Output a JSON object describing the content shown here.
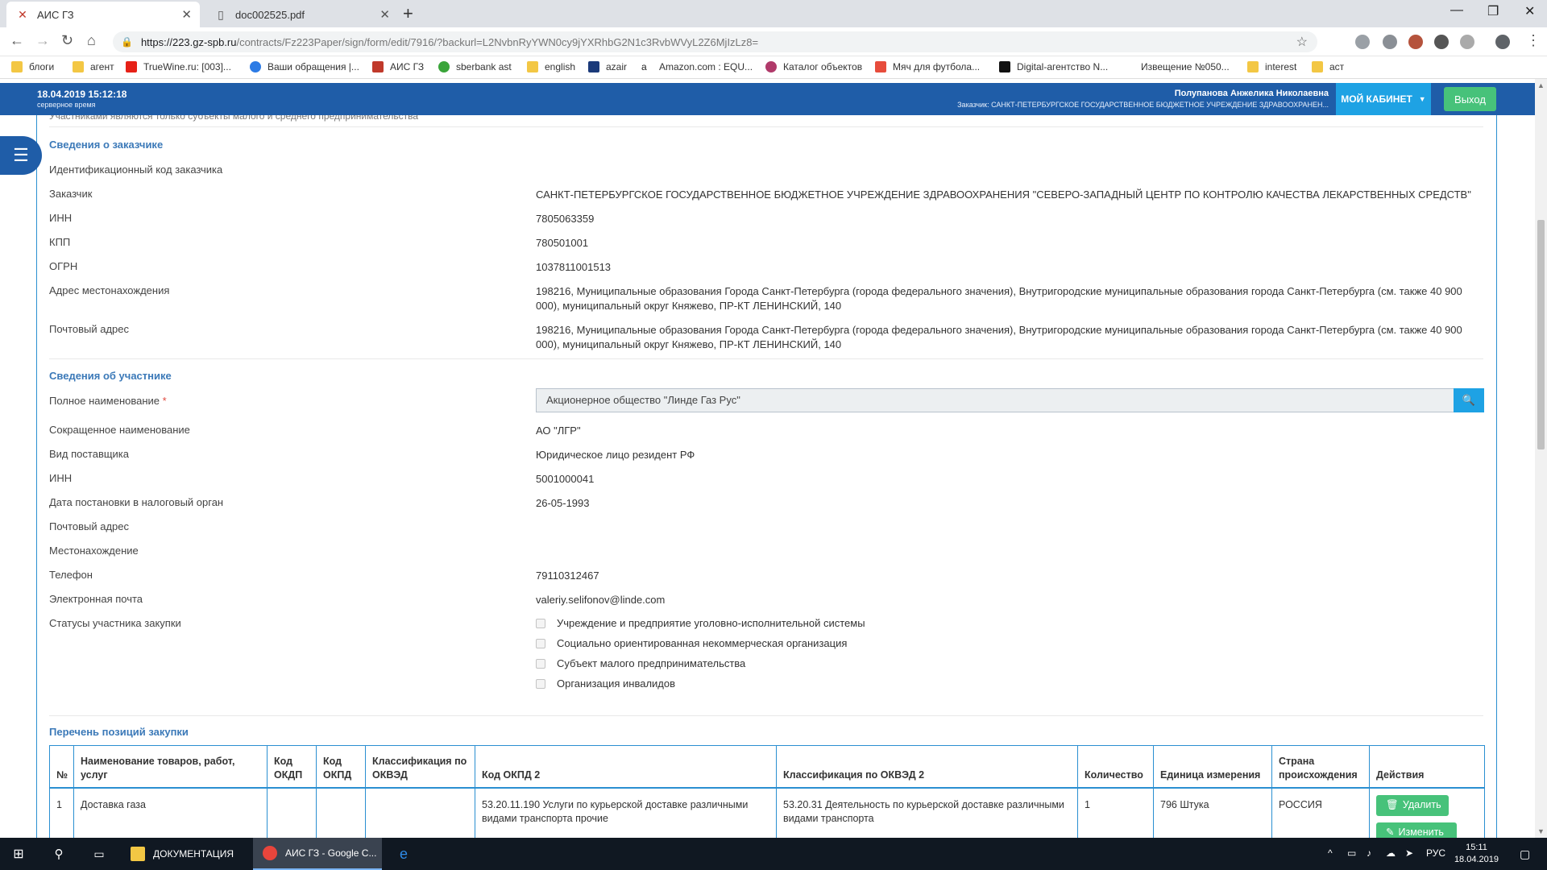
{
  "browser": {
    "tabs": [
      {
        "title": "АИС ГЗ",
        "active": true
      },
      {
        "title": "doc002525.pdf",
        "active": false
      }
    ],
    "url_host": "https://223.gz-spb.ru",
    "url_path": "/contracts/Fz223Paper/sign/form/edit/7916/?backurl=L2NvbnRyYWN0cy9jYXRhbG2N1c3RvbWVyL2Z6MjIzLz8=",
    "bookmarks": [
      {
        "label": "блоги",
        "color": "#f3c744"
      },
      {
        "label": "агент",
        "color": "#f3c744"
      },
      {
        "label": "TrueWine.ru: [003]...",
        "color": "#e62117"
      },
      {
        "label": "Ваши обращения |...",
        "color": "#2c7be5"
      },
      {
        "label": "АИС ГЗ",
        "color": "#c0392b"
      },
      {
        "label": "sberbank ast",
        "color": "#3aa53a"
      },
      {
        "label": "english",
        "color": "#f3c744"
      },
      {
        "label": "azair",
        "color": "#1b3a7a"
      },
      {
        "label": "Amazon.com : EQU...",
        "color": "#222222"
      },
      {
        "label": "Каталог объектов",
        "color": "#b03a6a"
      },
      {
        "label": "Мяч для футбола...",
        "color": "#e74c3c"
      },
      {
        "label": "Digital-агентство N...",
        "color": "#111111"
      },
      {
        "label": "Извещение №050...",
        "color": "#ffffff"
      },
      {
        "label": "interest",
        "color": "#f3c744"
      },
      {
        "label": "аст",
        "color": "#f3c744"
      }
    ]
  },
  "header": {
    "datetime": "18.04.2019 15:12:18",
    "timezone": "серверное время",
    "user_name": "Полупанова Анжелика Николаевна",
    "customer": "Заказчик: САНКТ-ПЕТЕРБУРГСКОЕ ГОСУДАРСТВЕННОЕ БЮДЖЕТНОЕ УЧРЕЖДЕНИЕ ЗДРАВООХРАНЕН...",
    "cabinet_label": "МОЙ КАБИНЕТ",
    "exit_label": "Выход"
  },
  "cutoff_text": "Участниками являются только субъекты малого и среднего предпринимательства",
  "customer_section": {
    "title": "Сведения о заказчике",
    "fields": [
      {
        "label": "Идентификационный код заказчика",
        "value": ""
      },
      {
        "label": "Заказчик",
        "value": "САНКТ-ПЕТЕРБУРГСКОЕ ГОСУДАРСТВЕННОЕ БЮДЖЕТНОЕ УЧРЕЖДЕНИЕ ЗДРАВООХРАНЕНИЯ \"СЕВЕРО-ЗАПАДНЫЙ ЦЕНТР ПО КОНТРОЛЮ КАЧЕСТВА ЛЕКАРСТВЕННЫХ СРЕДСТВ\""
      },
      {
        "label": "ИНН",
        "value": "7805063359"
      },
      {
        "label": "КПП",
        "value": "780501001"
      },
      {
        "label": "ОГРН",
        "value": "1037811001513"
      },
      {
        "label": "Адрес местонахождения",
        "value": "198216, Муниципальные образования Города Санкт-Петербурга (города федерального значения), Внутригородские муниципальные образования города Санкт-Петербурга (см. также 40 900 000), муниципальный округ Княжево, ПР-КТ ЛЕНИНСКИЙ, 140"
      },
      {
        "label": "Почтовый адрес",
        "value": "198216, Муниципальные образования Города Санкт-Петербурга (города федерального значения), Внутригородские муниципальные образования города Санкт-Петербурга (см. также 40 900 000), муниципальный округ Княжево, ПР-КТ ЛЕНИНСКИЙ, 140"
      }
    ]
  },
  "participant_section": {
    "title": "Сведения об участнике",
    "full_name_label": "Полное наименование",
    "required_mark": "*",
    "full_name_value": "Акционерное общество \"Линде Газ Рус\"",
    "fields": [
      {
        "label": "Сокращенное наименование",
        "value": "АО \"ЛГР\""
      },
      {
        "label": "Вид поставщика",
        "value": "Юридическое лицо резидент РФ"
      },
      {
        "label": "ИНН",
        "value": "5001000041"
      },
      {
        "label": "Дата постановки в налоговый орган",
        "value": "26-05-1993"
      },
      {
        "label": "Почтовый адрес",
        "value": ""
      },
      {
        "label": "Местонахождение",
        "value": ""
      },
      {
        "label": "Телефон",
        "value": "79110312467"
      },
      {
        "label": "Электронная почта",
        "value": "valeriy.selifonov@linde.com"
      }
    ],
    "statuses_label": "Статусы участника закупки",
    "statuses": [
      {
        "label": "Учреждение и предприятие уголовно-исполнительной системы",
        "checked": false
      },
      {
        "label": "Социально ориентированная некоммерческая организация",
        "checked": false
      },
      {
        "label": "Субъект малого предпринимательства",
        "checked": false
      },
      {
        "label": "Организация инвалидов",
        "checked": false
      }
    ]
  },
  "positions_section": {
    "title": "Перечень позиций закупки",
    "columns": [
      "№",
      "Наименование товаров, работ, услуг",
      "Код ОКДП",
      "Код ОКПД",
      "Классификация по ОКВЭД",
      "Код ОКПД 2",
      "Классификация по ОКВЭД 2",
      "Количество",
      "Единица измерения",
      "Страна происхождения",
      "Действия"
    ],
    "rows": [
      {
        "num": "1",
        "name": "Доставка газа",
        "okdp": "",
        "okpd": "",
        "okved": "",
        "okpd2": "53.20.11.190 Услуги по курьерской доставке различными видами транспорта прочие",
        "okved2": "53.20.31 Деятельность по курьерской доставке различными видами транспорта",
        "qty": "1",
        "unit": "796 Штука",
        "country": "РОССИЯ",
        "delete_label": "Удалить",
        "edit_label": "Изменить"
      }
    ]
  },
  "taskbar": {
    "apps": [
      {
        "label": "ДОКУМЕНТАЦИЯ",
        "active": false
      },
      {
        "label": "АИС ГЗ - Google C...",
        "active": true
      }
    ],
    "lang": "РУС",
    "time": "15:11",
    "date": "18.04.2019"
  },
  "colors": {
    "header_blue": "#1f5da8",
    "accent_cyan": "#1ea2e4",
    "success_green": "#47c27a",
    "section_title": "#3b79b8"
  }
}
